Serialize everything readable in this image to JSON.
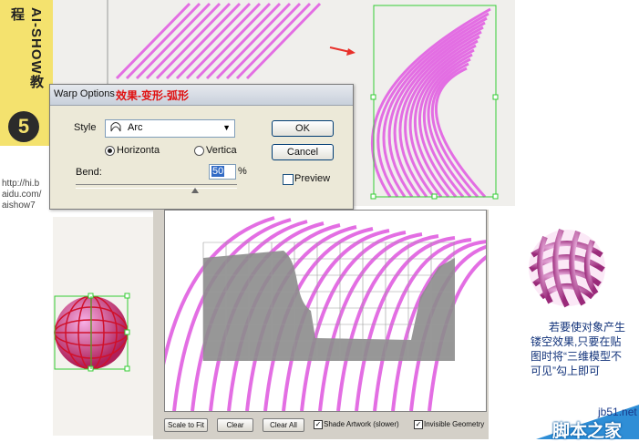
{
  "badge": {
    "text": "AI-SHOW教程",
    "step": "5"
  },
  "source_url": "http://hi.b\naidu.com/\naishow7",
  "dialog": {
    "title": "Warp Options",
    "annotation": "效果-变形-弧形",
    "style_label": "Style",
    "style_value": "Arc",
    "orient_h": "Horizonta",
    "orient_v": "Vertica",
    "orientation_selected": "Horizontal",
    "bend_label": "Bend:",
    "bend_value": "50",
    "bend_unit": "%",
    "ok": "OK",
    "cancel": "Cancel",
    "preview": "Preview",
    "preview_checked": false
  },
  "panel3d": {
    "scale_to_fit": "Scale to Fit",
    "clear": "Clear",
    "clear_all": "Clear All",
    "shade_artwork": "Shade Artwork (slower)",
    "shade_checked": true,
    "invisible_geometry": "Invisible Geometry",
    "invisible_checked": true
  },
  "note": "若要使对象产生镂空效果,只要在贴图时将“三维模型不可见”勾上即可",
  "watermark": {
    "url": "jb51.net",
    "name": "脚本之家"
  },
  "colors": {
    "stripe": "#e36ee3",
    "selection": "#33cc33",
    "annotation": "#e01010",
    "arrow": "#e8302a"
  }
}
